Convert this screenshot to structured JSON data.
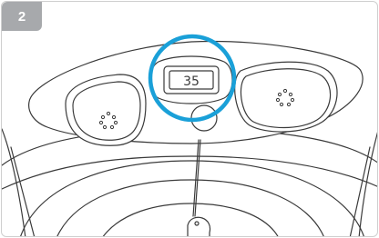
{
  "step": {
    "number": "2"
  },
  "display": {
    "reading": "35"
  },
  "colors": {
    "highlight_ring": "#1aa0d8",
    "badge": "#a7a9ac",
    "line": "#3a3a3a"
  },
  "icons": [
    "speaker-grille-icon",
    "digital-display-icon"
  ]
}
